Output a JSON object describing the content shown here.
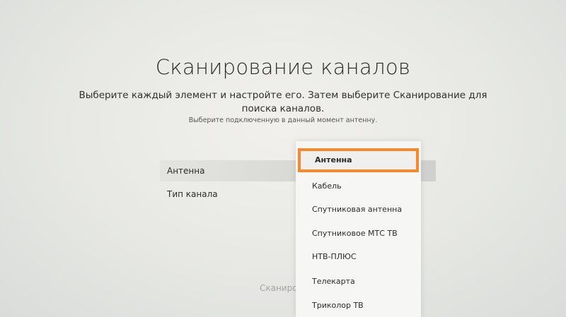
{
  "page": {
    "title": "Сканирование каналов",
    "description": "Выберите каждый элемент и настройте его. Затем выберите Сканирование для поиска каналов.",
    "hint": "Выберите подключенную в данный момент антенну."
  },
  "settings": [
    {
      "label": "Антенна"
    },
    {
      "label": "Тип канала"
    }
  ],
  "scan_button": {
    "label": "Сканирова"
  },
  "dropdown": {
    "items": [
      {
        "label": "Антенна"
      },
      {
        "label": "Кабель"
      },
      {
        "label": "Спутниковая антенна"
      },
      {
        "label": "Спутниковое МТС ТВ"
      },
      {
        "label": "НТВ-ПЛЮС"
      },
      {
        "label": "Телекарта"
      },
      {
        "label": "Триколор ТВ"
      }
    ]
  },
  "colors": {
    "focus_ring": "#f5892c",
    "background": "#e7e8e4",
    "dropdown_bg": "#f6f6f4"
  }
}
